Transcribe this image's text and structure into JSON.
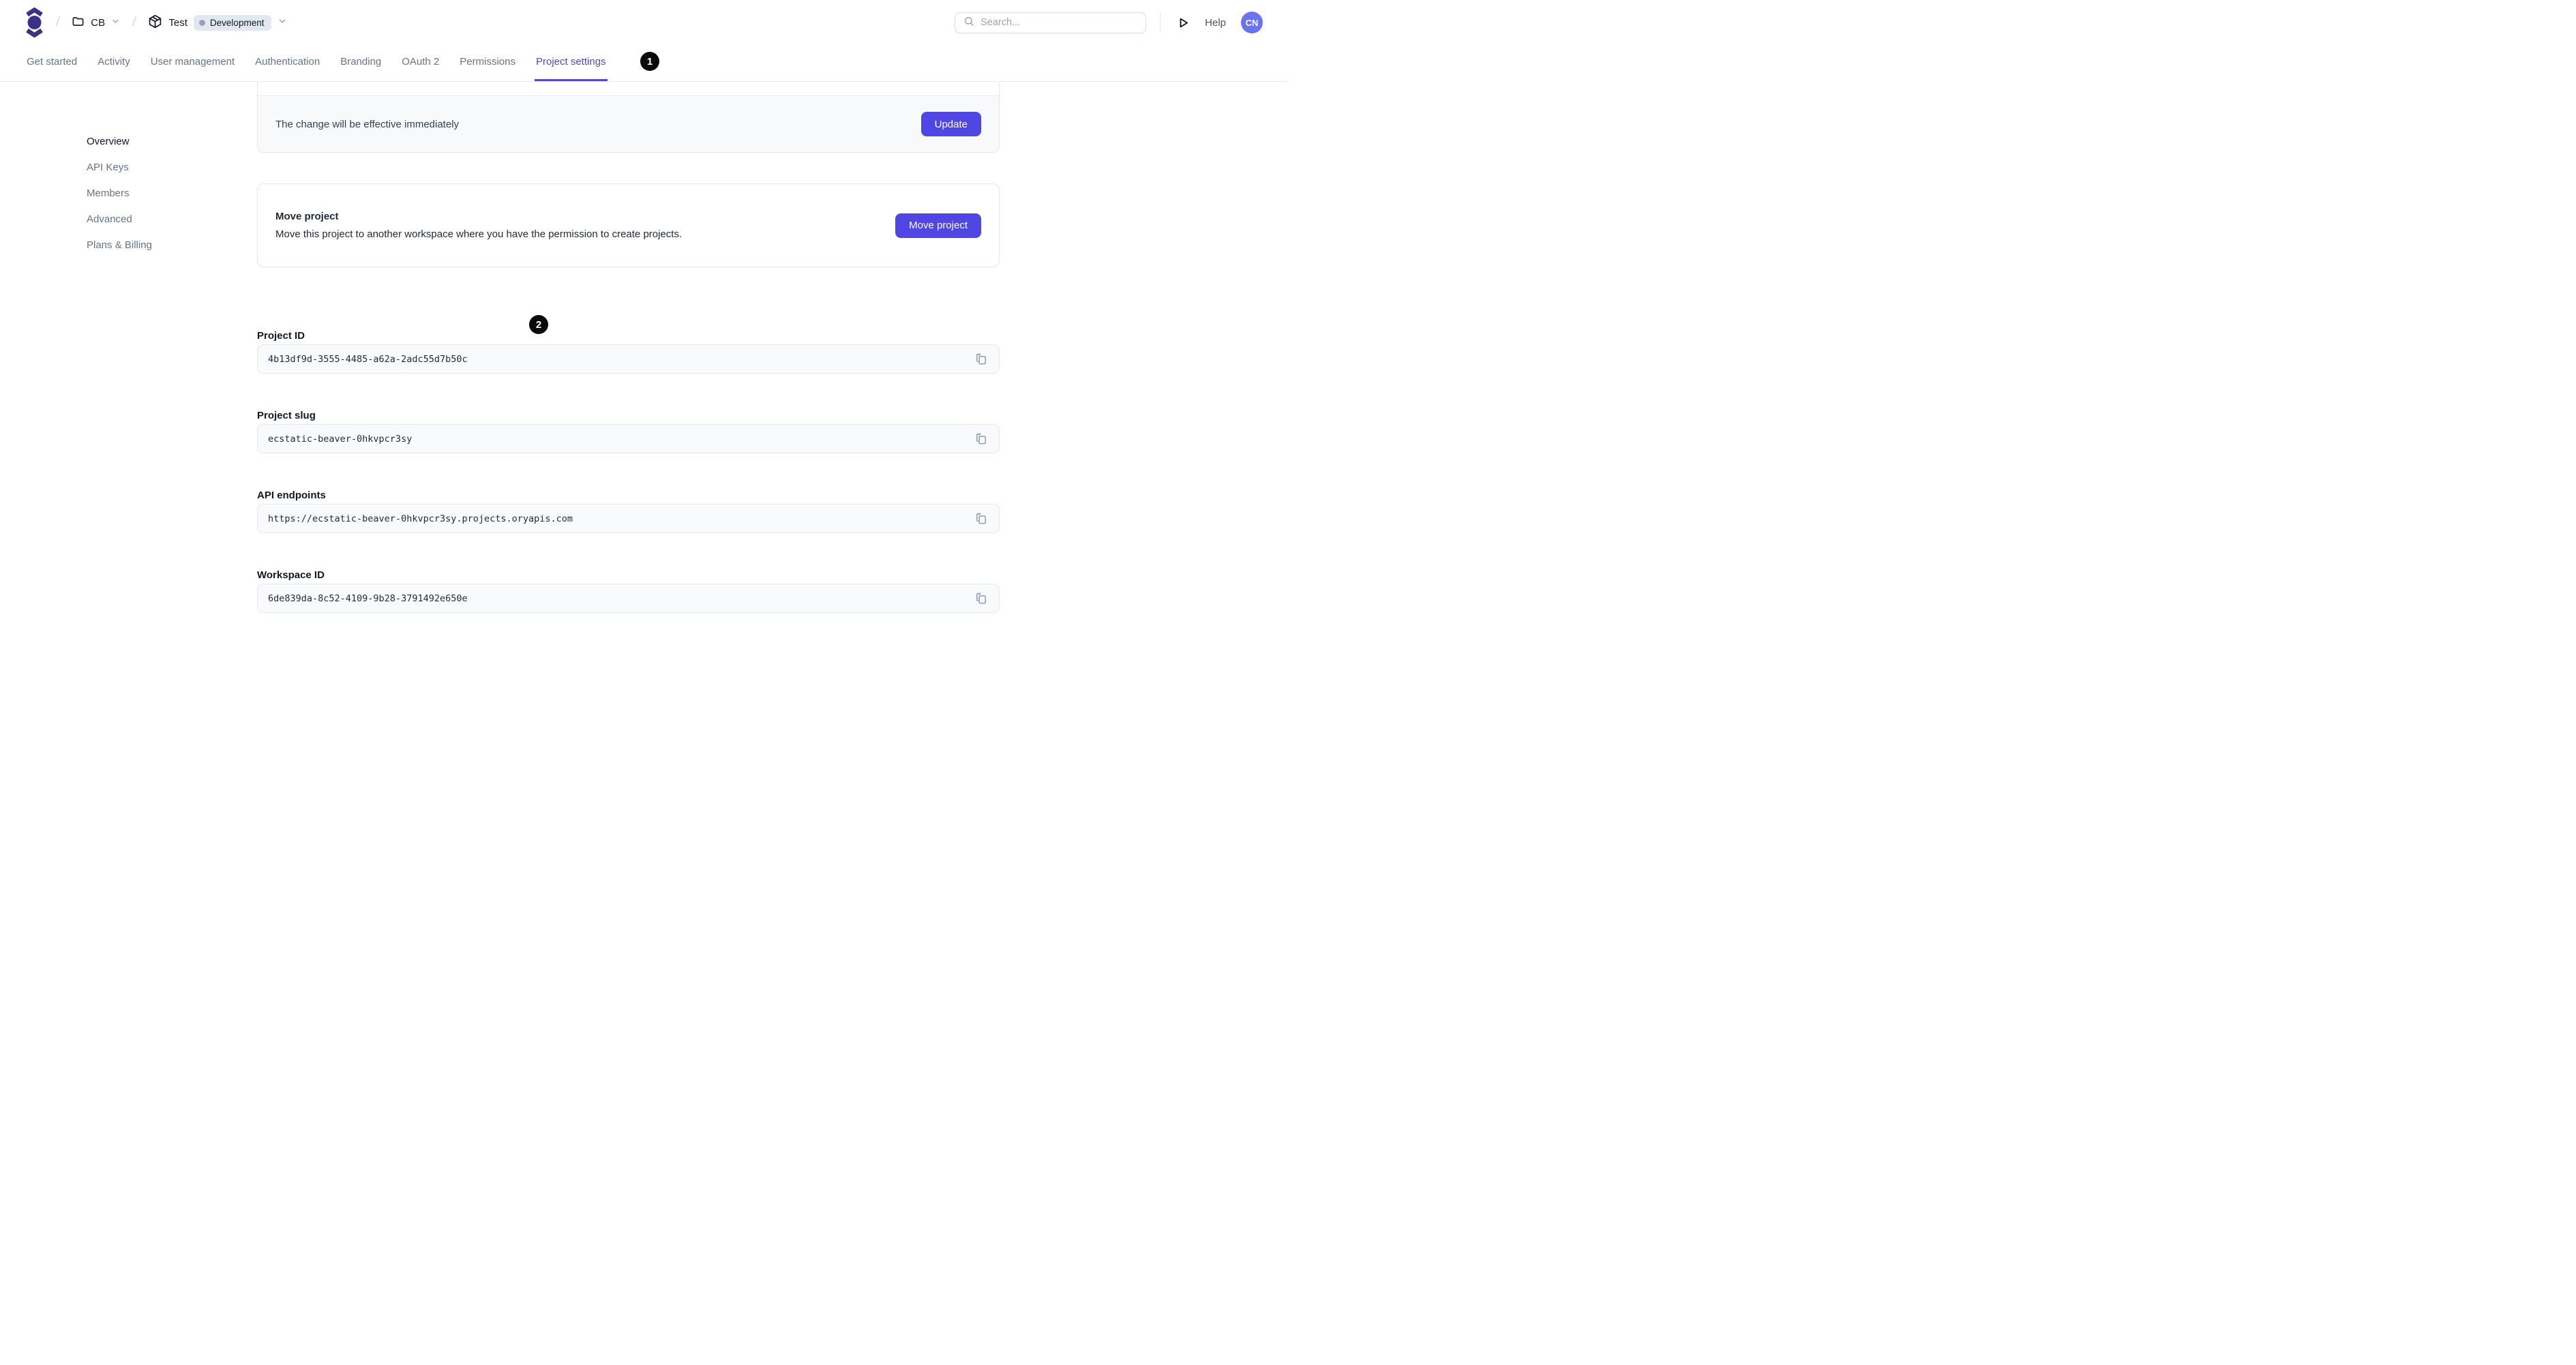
{
  "header": {
    "breadcrumb": {
      "workspace_label": "CB",
      "project_label": "Test",
      "environment_label": "Development"
    },
    "search": {
      "placeholder": "Search..."
    },
    "help_label": "Help",
    "avatar_initials": "CN"
  },
  "tabs": {
    "items": [
      "Get started",
      "Activity",
      "User management",
      "Authentication",
      "Branding",
      "OAuth 2",
      "Permissions",
      "Project settings"
    ],
    "active": "Project settings"
  },
  "annotations": [
    {
      "number": "1"
    },
    {
      "number": "2"
    }
  ],
  "sidebar": {
    "items": [
      "Overview",
      "API Keys",
      "Members",
      "Advanced",
      "Plans & Billing"
    ],
    "active": "Overview"
  },
  "update_card": {
    "message": "The change will be effective immediately",
    "button_label": "Update"
  },
  "move_card": {
    "title": "Move project",
    "description": "Move this project to another workspace where you have the permission to create projects.",
    "button_label": "Move project"
  },
  "fields": [
    {
      "label": "Project ID",
      "value": "4b13df9d-3555-4485-a62a-2adc55d7b50c"
    },
    {
      "label": "Project slug",
      "value": "ecstatic-beaver-0hkvpcr3sy"
    },
    {
      "label": "API endpoints",
      "value": "https://ecstatic-beaver-0hkvpcr3sy.projects.oryapis.com"
    },
    {
      "label": "Workspace ID",
      "value": "6de839da-8c52-4109-9b28-3791492e650e"
    }
  ],
  "colors": {
    "accent": "#4f46e5",
    "logo": "#3a3286",
    "avatar_bg": "#6873f2",
    "badge_bg": "#e2e8f0",
    "badge_dot": "#94a3b8",
    "field_bg": "#f8fafc",
    "footer_bg": "#f8f9fb",
    "annotation_bg": "#0a0a0a"
  }
}
